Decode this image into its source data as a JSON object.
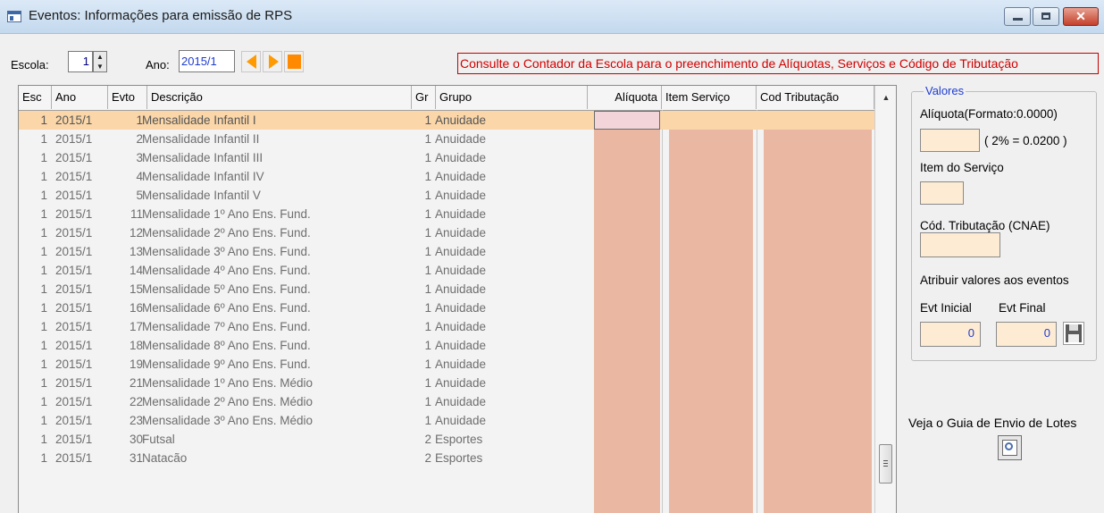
{
  "window": {
    "title": "Eventos: Informações para emissão de RPS",
    "min_icon": "minimize-icon",
    "max_icon": "maximize-icon",
    "close_icon": "close-icon",
    "close_glyph": "✕"
  },
  "toolbar": {
    "escola_label": "Escola:",
    "escola_value": "1",
    "ano_label": "Ano:",
    "ano_value": "2015/1",
    "notice": "Consulte o Contador da Escola para o preenchimento de Alíquotas, Serviços e Código de Tributação",
    "accent_color": "#ff9a00",
    "notice_color": "#d00000"
  },
  "grid": {
    "headers": {
      "esc": "Esc",
      "ano": "Ano",
      "evto": "Evto",
      "descricao": "Descrição",
      "gr": "Gr",
      "grupo": "Grupo",
      "aliquota": "Alíquota",
      "item_servico": "Item Serviço",
      "cod_tributacao": "Cod Tributação"
    },
    "rows": [
      {
        "esc": "1",
        "ano": "2015/1",
        "evto": "1",
        "descricao": "Mensalidade Infantil I",
        "gr": "1",
        "grupo": "Anuidade"
      },
      {
        "esc": "1",
        "ano": "2015/1",
        "evto": "2",
        "descricao": "Mensalidade Infantil II",
        "gr": "1",
        "grupo": "Anuidade"
      },
      {
        "esc": "1",
        "ano": "2015/1",
        "evto": "3",
        "descricao": "Mensalidade Infantil III",
        "gr": "1",
        "grupo": "Anuidade"
      },
      {
        "esc": "1",
        "ano": "2015/1",
        "evto": "4",
        "descricao": "Mensalidade Infantil IV",
        "gr": "1",
        "grupo": "Anuidade"
      },
      {
        "esc": "1",
        "ano": "2015/1",
        "evto": "5",
        "descricao": "Mensalidade Infantil V",
        "gr": "1",
        "grupo": "Anuidade"
      },
      {
        "esc": "1",
        "ano": "2015/1",
        "evto": "11",
        "descricao": "Mensalidade 1º Ano Ens. Fund.",
        "gr": "1",
        "grupo": "Anuidade"
      },
      {
        "esc": "1",
        "ano": "2015/1",
        "evto": "12",
        "descricao": "Mensalidade 2º Ano Ens. Fund.",
        "gr": "1",
        "grupo": "Anuidade"
      },
      {
        "esc": "1",
        "ano": "2015/1",
        "evto": "13",
        "descricao": "Mensalidade 3º Ano Ens. Fund.",
        "gr": "1",
        "grupo": "Anuidade"
      },
      {
        "esc": "1",
        "ano": "2015/1",
        "evto": "14",
        "descricao": "Mensalidade 4º Ano Ens. Fund.",
        "gr": "1",
        "grupo": "Anuidade"
      },
      {
        "esc": "1",
        "ano": "2015/1",
        "evto": "15",
        "descricao": "Mensalidade 5º Ano Ens. Fund.",
        "gr": "1",
        "grupo": "Anuidade"
      },
      {
        "esc": "1",
        "ano": "2015/1",
        "evto": "16",
        "descricao": "Mensalidade 6º Ano Ens. Fund.",
        "gr": "1",
        "grupo": "Anuidade"
      },
      {
        "esc": "1",
        "ano": "2015/1",
        "evto": "17",
        "descricao": "Mensalidade 7º Ano Ens. Fund.",
        "gr": "1",
        "grupo": "Anuidade"
      },
      {
        "esc": "1",
        "ano": "2015/1",
        "evto": "18",
        "descricao": "Mensalidade 8º Ano Ens. Fund.",
        "gr": "1",
        "grupo": "Anuidade"
      },
      {
        "esc": "1",
        "ano": "2015/1",
        "evto": "19",
        "descricao": "Mensalidade 9º Ano Ens. Fund.",
        "gr": "1",
        "grupo": "Anuidade"
      },
      {
        "esc": "1",
        "ano": "2015/1",
        "evto": "21",
        "descricao": "Mensalidade 1º Ano Ens. Médio",
        "gr": "1",
        "grupo": "Anuidade"
      },
      {
        "esc": "1",
        "ano": "2015/1",
        "evto": "22",
        "descricao": "Mensalidade 2º Ano Ens. Médio",
        "gr": "1",
        "grupo": "Anuidade"
      },
      {
        "esc": "1",
        "ano": "2015/1",
        "evto": "23",
        "descricao": "Mensalidade 3º Ano Ens. Médio",
        "gr": "1",
        "grupo": "Anuidade"
      },
      {
        "esc": "1",
        "ano": "2015/1",
        "evto": "30",
        "descricao": "Futsal",
        "gr": "2",
        "grupo": "Esportes"
      },
      {
        "esc": "1",
        "ano": "2015/1",
        "evto": "31",
        "descricao": "Natacão",
        "gr": "2",
        "grupo": "Esportes"
      }
    ],
    "selected_row": 0,
    "highlight_color": "#fbd6a8",
    "editable_column_color": "#eab8a2"
  },
  "valores": {
    "group_title": "Valores",
    "aliquota_label": "Alíquota(Formato:0.0000)",
    "aliquota_value": "",
    "aliquota_hint": "( 2% = 0.0200 )",
    "item_servico_label": "Item do Serviço",
    "item_servico_value": "",
    "cod_tributacao_label": "Cód. Tributação (CNAE)",
    "cod_tributacao_value": "",
    "atribuir_label": "Atribuir valores aos eventos",
    "evt_inicial_label": "Evt Inicial",
    "evt_final_label": "Evt Final",
    "evt_inicial_value": "0",
    "evt_final_value": "0",
    "save_icon": "floppy-disk-icon"
  },
  "guia": {
    "label": "Veja o Guia de Envio de Lotes",
    "icon": "magnifier-icon"
  }
}
